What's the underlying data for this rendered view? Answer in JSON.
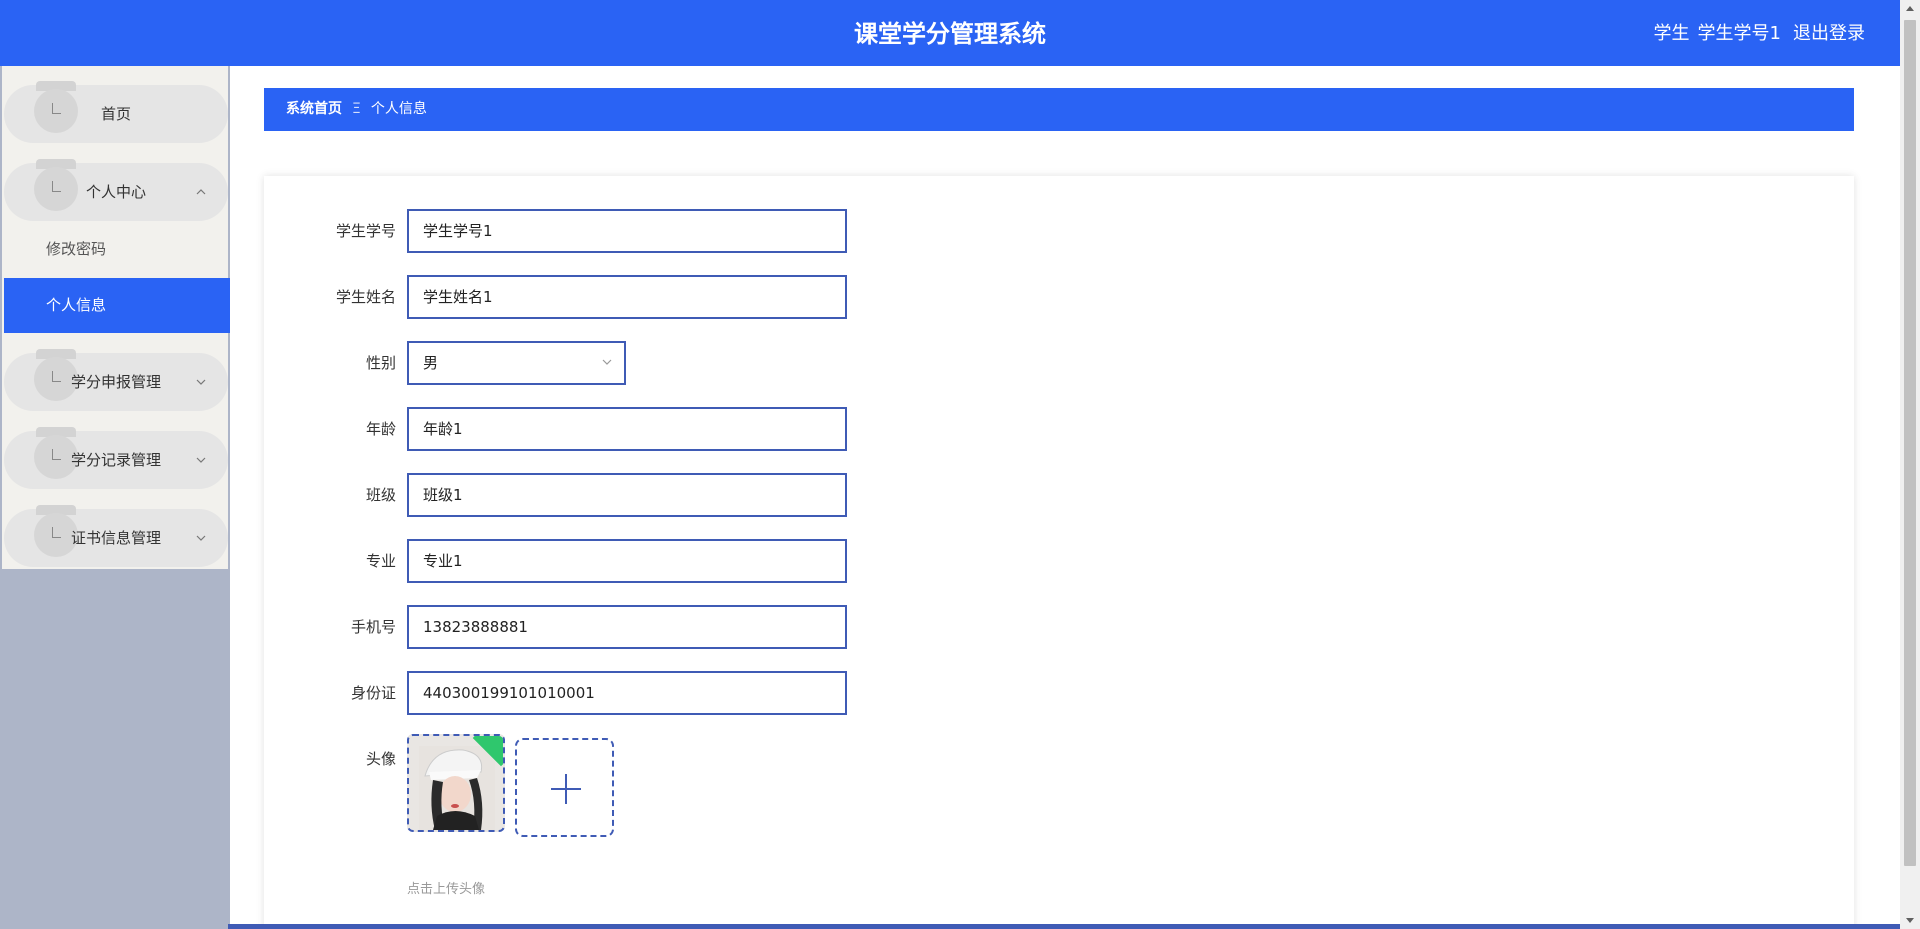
{
  "header": {
    "title": "课堂学分管理系统",
    "role": "学生",
    "username": "学生学号1",
    "logout_label": "退出登录"
  },
  "sidebar": {
    "items": [
      {
        "label": "首页"
      },
      {
        "label": "个人中心",
        "expanded": true,
        "children": [
          {
            "label": "修改密码"
          },
          {
            "label": "个人信息",
            "active": true
          }
        ]
      },
      {
        "label": "学分申报管理"
      },
      {
        "label": "学分记录管理"
      },
      {
        "label": "证书信息管理"
      }
    ]
  },
  "breadcrumb": {
    "home": "系统首页",
    "separator": "Ξ",
    "current": "个人信息"
  },
  "form": {
    "student_id": {
      "label": "学生学号",
      "value": "学生学号1"
    },
    "student_name": {
      "label": "学生姓名",
      "value": "学生姓名1"
    },
    "gender": {
      "label": "性别",
      "value": "男"
    },
    "age": {
      "label": "年龄",
      "value": "年龄1"
    },
    "class": {
      "label": "班级",
      "value": "班级1"
    },
    "major": {
      "label": "专业",
      "value": "专业1"
    },
    "phone": {
      "label": "手机号",
      "value": "13823888881"
    },
    "id_card": {
      "label": "身份证",
      "value": "440300199101010001"
    },
    "avatar": {
      "label": "头像",
      "hint": "点击上传头像"
    }
  },
  "colors": {
    "primary": "#2a63f4",
    "border": "#3f5bb5",
    "sidebar_bg": "#f2f1ed",
    "success": "#2fc76d"
  }
}
